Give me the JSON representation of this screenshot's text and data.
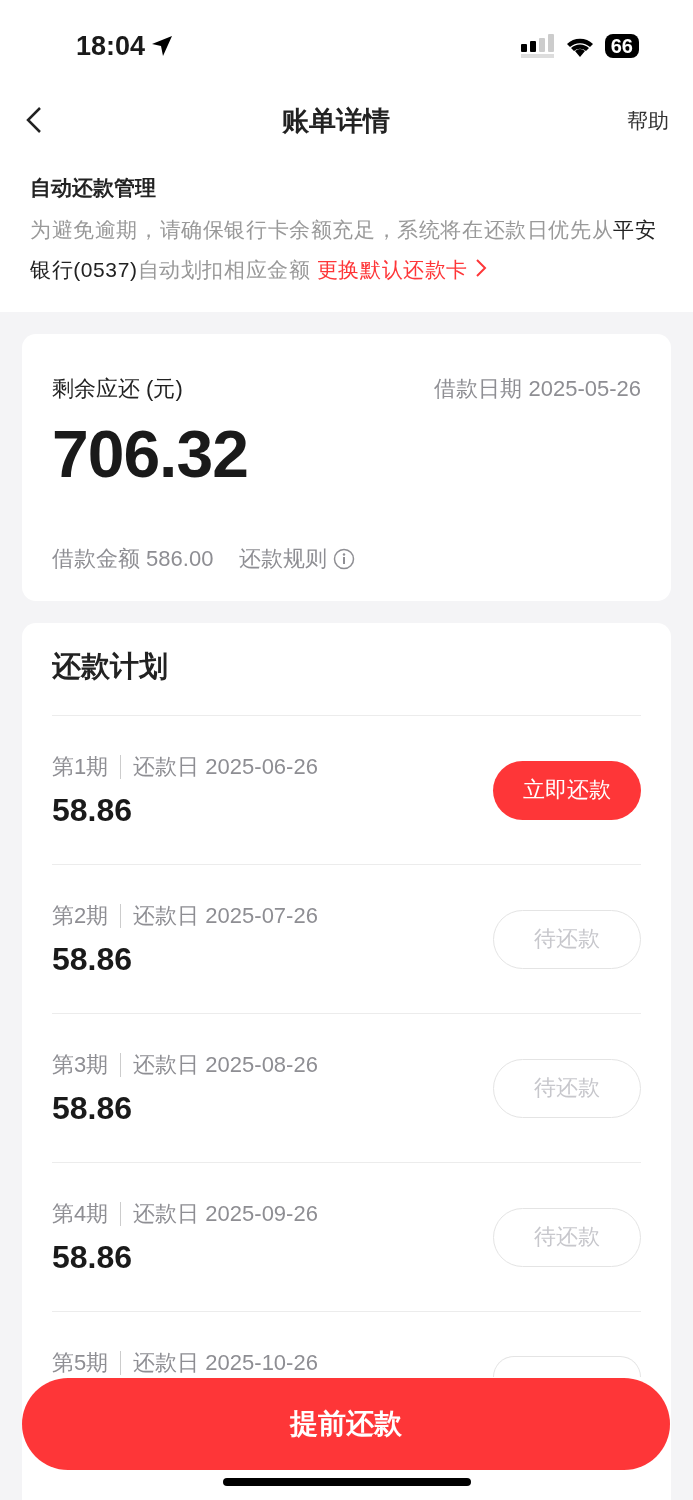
{
  "status_bar": {
    "time": "18:04",
    "battery": "66"
  },
  "nav": {
    "title": "账单详情",
    "help": "帮助"
  },
  "auto_repay": {
    "title": "自动还款管理",
    "description": [
      {
        "text": "为避免逾期，请确保银行卡余额充足，系统将在还款日优先从",
        "kind": "plain"
      },
      {
        "text": "平安银行(0537)",
        "kind": "bank"
      },
      {
        "text": "自动划扣相应金额",
        "kind": "plain"
      }
    ],
    "link": "更换默认还款卡"
  },
  "summary": {
    "label": "剩余应还 (元)",
    "loan_date": "借款日期 2025-05-26",
    "amount": "706.32",
    "loan_amount": "借款金额 586.00",
    "rules": "还款规则"
  },
  "plan": {
    "title": "还款计划",
    "installments": [
      {
        "period": "第1期",
        "due_date": "还款日 2025-06-26",
        "amount": "58.86",
        "kind": "due",
        "action": "立即还款"
      },
      {
        "period": "第2期",
        "due_date": "还款日 2025-07-26",
        "amount": "58.86",
        "kind": "pending",
        "action": "待还款"
      },
      {
        "period": "第3期",
        "due_date": "还款日 2025-08-26",
        "amount": "58.86",
        "kind": "pending",
        "action": "待还款"
      },
      {
        "period": "第4期",
        "due_date": "还款日 2025-09-26",
        "amount": "58.86",
        "kind": "pending",
        "action": "待还款"
      },
      {
        "period": "第5期",
        "due_date": "还款日 2025-10-26",
        "kind": "pending"
      }
    ]
  },
  "prepay_button": "提前还款"
}
